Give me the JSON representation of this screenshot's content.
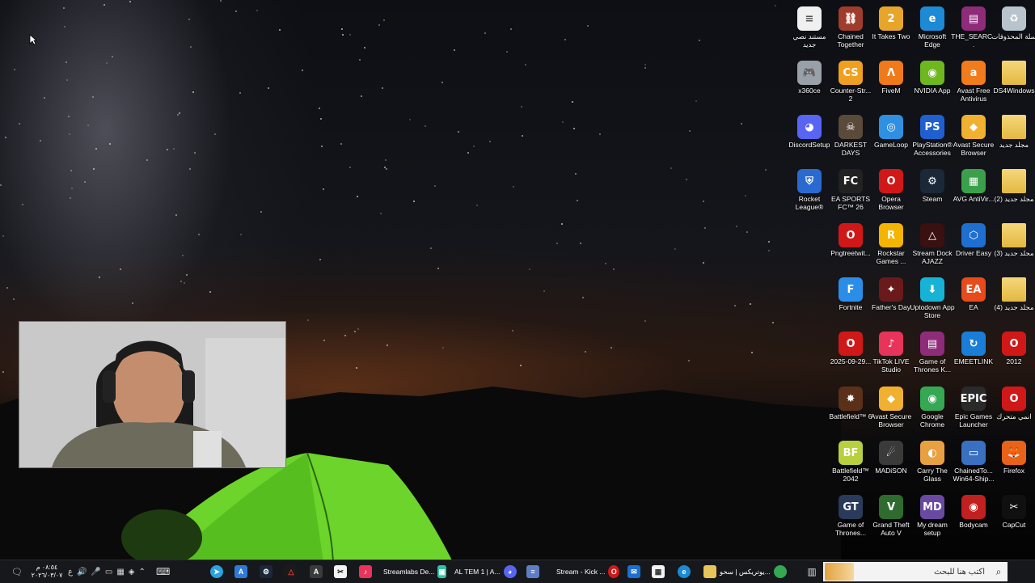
{
  "desktop": {
    "icons": [
      {
        "label": "مستند نصي جديد",
        "icon": "document-icon",
        "color": "#f0f0f0",
        "glyph": "≡"
      },
      {
        "label": "Chained Together",
        "icon": "chained-together-icon",
        "color": "#a03c2c",
        "glyph": "⛓"
      },
      {
        "label": "It Takes Two",
        "icon": "it-takes-two-icon",
        "color": "#e7a52a",
        "glyph": "2"
      },
      {
        "label": "Microsoft Edge",
        "icon": "edge-icon",
        "color": "#1d8ad6",
        "glyph": "e"
      },
      {
        "label": "THE_SEARC...",
        "icon": "winrar-icon",
        "color": "#8e2c7a",
        "glyph": "▤"
      },
      {
        "label": "سلة المحذوفات",
        "icon": "recycle-bin-icon",
        "color": "#b8c4cc",
        "glyph": "♻"
      },
      {
        "label": "x360ce",
        "icon": "gamepad-icon",
        "color": "#9aa0a8",
        "glyph": "🎮"
      },
      {
        "label": "Counter-Str... 2",
        "icon": "counter-strike-icon",
        "color": "#f0a020",
        "glyph": "CS"
      },
      {
        "label": "FiveM",
        "icon": "fivem-icon",
        "color": "#f07a1a",
        "glyph": "Λ"
      },
      {
        "label": "NVIDIA App",
        "icon": "nvidia-icon",
        "color": "#6fb71f",
        "glyph": "◉"
      },
      {
        "label": "Avast Free Antivirus",
        "icon": "avast-icon",
        "color": "#f27b1c",
        "glyph": "a"
      },
      {
        "label": "DS4Windows",
        "icon": "folder-icon",
        "color": "#e8c55a",
        "glyph": ""
      },
      {
        "label": "DiscordSetup",
        "icon": "discord-icon",
        "color": "#5865f2",
        "glyph": "◕"
      },
      {
        "label": "DARKEST DAYS",
        "icon": "darkest-days-icon",
        "color": "#5a4a3a",
        "glyph": "☠"
      },
      {
        "label": "GameLoop",
        "icon": "gameloop-icon",
        "color": "#2f8fe0",
        "glyph": "◎"
      },
      {
        "label": "PlayStation® Accessories",
        "icon": "playstation-icon",
        "color": "#1f5fcf",
        "glyph": "PS"
      },
      {
        "label": "Avast Secure Browser",
        "icon": "avast-browser-icon",
        "color": "#f0b030",
        "glyph": "◆"
      },
      {
        "label": "مجلد جديد",
        "icon": "folder-icon",
        "color": "#e8c55a",
        "glyph": ""
      },
      {
        "label": "Rocket League®",
        "icon": "rocket-league-icon",
        "color": "#2a6ad0",
        "glyph": "⛨"
      },
      {
        "label": "EA SPORTS FC™ 26",
        "icon": "ea-fc-icon",
        "color": "#222222",
        "glyph": "FC"
      },
      {
        "label": "Opera Browser",
        "icon": "opera-icon",
        "color": "#d01818",
        "glyph": "O"
      },
      {
        "label": "Steam",
        "icon": "steam-icon",
        "color": "#1b2838",
        "glyph": "⚙"
      },
      {
        "label": "AVG AntiVir...",
        "icon": "avg-icon",
        "color": "#3aa04a",
        "glyph": "▦"
      },
      {
        "label": "مجلد جديد (2)",
        "icon": "folder-icon",
        "color": "#e8c55a",
        "glyph": ""
      },
      {
        "label": "Pngtreetwit...",
        "icon": "opera-icon",
        "color": "#d01818",
        "glyph": "O"
      },
      {
        "label": "Rockstar Games ...",
        "icon": "rockstar-icon",
        "color": "#f4b400",
        "glyph": "R"
      },
      {
        "label": "Stream Dock AJAZZ",
        "icon": "stream-dock-icon",
        "color": "#3a1010",
        "glyph": "△"
      },
      {
        "label": "Driver Easy",
        "icon": "driver-easy-icon",
        "color": "#1f6fd0",
        "glyph": "⬡"
      },
      {
        "label": "مجلد جديد (3)",
        "icon": "folder-icon",
        "color": "#e8c55a",
        "glyph": ""
      },
      {
        "label": "Fortnite",
        "icon": "fortnite-icon",
        "color": "#2a8ee8",
        "glyph": "F"
      },
      {
        "label": "Father's Day",
        "icon": "fathers-day-icon",
        "color": "#6a1a1a",
        "glyph": "✦"
      },
      {
        "label": "Uptodown App Store",
        "icon": "uptodown-icon",
        "color": "#17b3d6",
        "glyph": "⬇"
      },
      {
        "label": "EA",
        "icon": "ea-icon",
        "color": "#e84a1a",
        "glyph": "EA"
      },
      {
        "label": "مجلد جديد (4)",
        "icon": "folder-icon",
        "color": "#e8c55a",
        "glyph": ""
      },
      {
        "label": "2025-09-29...",
        "icon": "opera-icon",
        "color": "#d01818",
        "glyph": "O"
      },
      {
        "label": "TikTok LIVE Studio",
        "icon": "tiktok-icon",
        "color": "#e8335a",
        "glyph": "♪"
      },
      {
        "label": "Game of Thrones K...",
        "icon": "winrar-icon",
        "color": "#8e2c7a",
        "glyph": "▤"
      },
      {
        "label": "EMEETLINK",
        "icon": "emeetlink-icon",
        "color": "#1a7ed8",
        "glyph": "↻"
      },
      {
        "label": "2012",
        "icon": "opera-icon",
        "color": "#d01818",
        "glyph": "O"
      },
      {
        "label": "Battlefield™ 6",
        "icon": "battlefield-6-icon",
        "color": "#5a3018",
        "glyph": "✸"
      },
      {
        "label": "Avast Secure Browser",
        "icon": "avast-browser-icon",
        "color": "#f0b030",
        "glyph": "◆"
      },
      {
        "label": "Google Chrome",
        "icon": "chrome-icon",
        "color": "#34a853",
        "glyph": "◉"
      },
      {
        "label": "Epic Games Launcher",
        "icon": "epic-games-icon",
        "color": "#2a2a2a",
        "glyph": "EPIC"
      },
      {
        "label": "انمي متحرك",
        "icon": "opera-icon",
        "color": "#d01818",
        "glyph": "O"
      },
      {
        "label": "Battlefield™ 2042",
        "icon": "battlefield-2042-icon",
        "color": "#b8d040",
        "glyph": "BF"
      },
      {
        "label": "MADiSON",
        "icon": "madison-icon",
        "color": "#3a3a3a",
        "glyph": "☄"
      },
      {
        "label": "Carry The Glass",
        "icon": "carry-the-glass-icon",
        "color": "#e8a040",
        "glyph": "◐"
      },
      {
        "label": "ChainedTo... Win64-Ship...",
        "icon": "exe-icon",
        "color": "#3a70c0",
        "glyph": "▭"
      },
      {
        "label": "Firefox",
        "icon": "firefox-icon",
        "color": "#e8621a",
        "glyph": "🦊"
      },
      {
        "label": "Game of Thrones...",
        "icon": "game-of-thrones-icon",
        "color": "#2a3a5a",
        "glyph": "GT"
      },
      {
        "label": "Grand Theft Auto V",
        "icon": "gta-v-icon",
        "color": "#2f6a2f",
        "glyph": "V"
      },
      {
        "label": "My dream setup",
        "icon": "my-dream-setup-icon",
        "color": "#6a4aa0",
        "glyph": "MD"
      },
      {
        "label": "Bodycam",
        "icon": "bodycam-icon",
        "color": "#c02020",
        "glyph": "◉"
      },
      {
        "label": "CapCut",
        "icon": "capcut-icon",
        "color": "#101010",
        "glyph": "✂"
      }
    ]
  },
  "taskbar": {
    "search_placeholder": "اكتب هنا للبحث",
    "items": [
      {
        "label": "يوتريكس | سحو...",
        "icon": "chrome-icon",
        "color": "#34a853"
      },
      {
        "label": "Stream - Kick ...",
        "icon": "opera-icon",
        "color": "#d01818"
      },
      {
        "label": "AL TEM 1 | A...",
        "icon": "discord-icon",
        "color": "#5865f2"
      },
      {
        "label": "Streamlabs De...",
        "icon": "streamlabs-icon",
        "color": "#31c3a2"
      }
    ],
    "clock_time": "٠٨:٥٤ م",
    "clock_date": "٢٠٢٦/٠٣/٠٧",
    "lang": "ع"
  }
}
